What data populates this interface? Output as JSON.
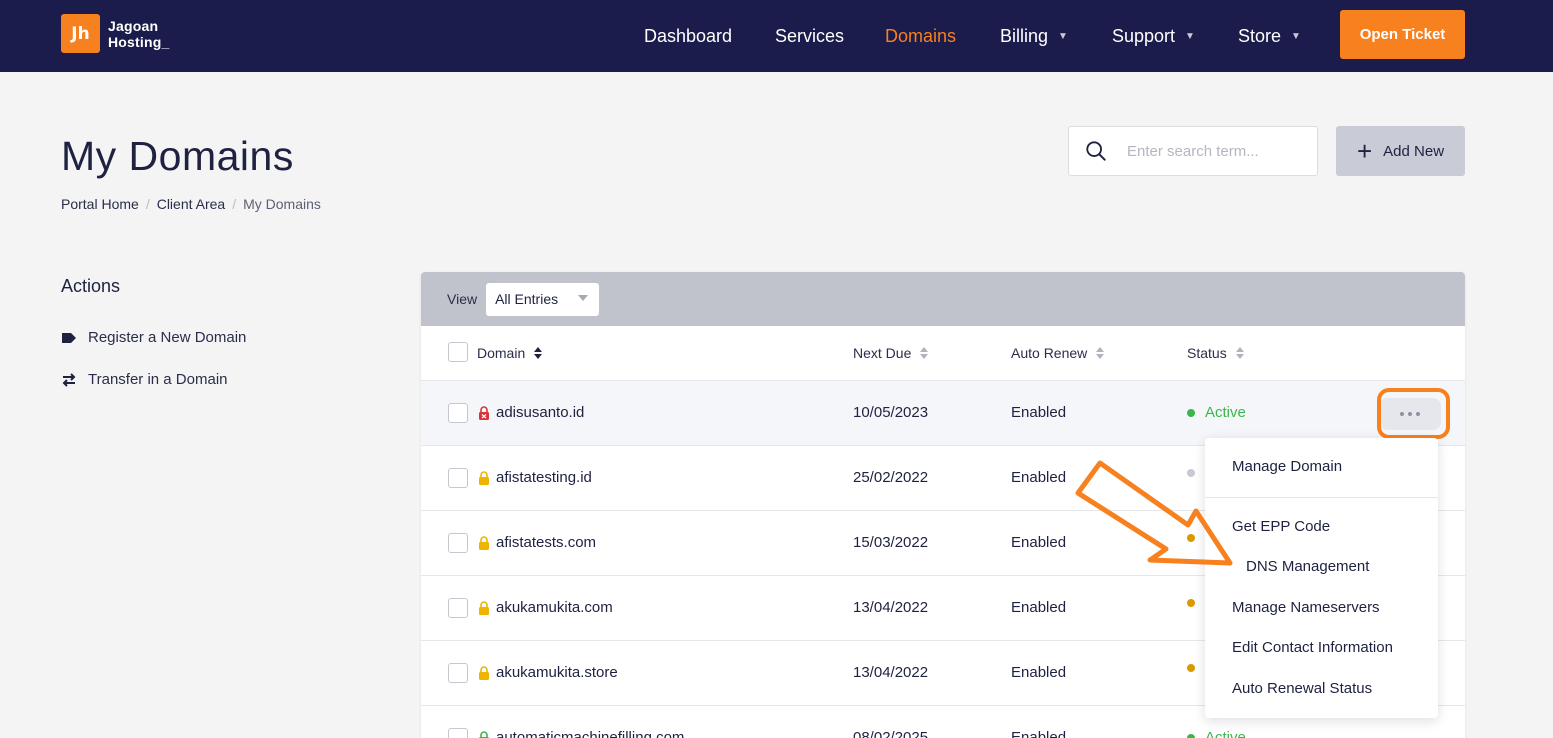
{
  "brand": {
    "mark": "Jh",
    "name": "Jagoan\nHosting_",
    "accent": "#f7801f",
    "navy": "#1b1c4b"
  },
  "nav": {
    "dashboard": "Dashboard",
    "services": "Services",
    "domains": "Domains",
    "billing": "Billing",
    "support": "Support",
    "store": "Store",
    "open_ticket": "Open Ticket"
  },
  "page": {
    "title": "My Domains"
  },
  "breadcrumb": {
    "home": "Portal Home",
    "client": "Client Area",
    "current": "My Domains",
    "sep": "/"
  },
  "search": {
    "placeholder": "Enter search term..."
  },
  "add_new": {
    "label": "Add New"
  },
  "sidebar": {
    "title": "Actions",
    "items": [
      {
        "label": "Register a New Domain",
        "icon": "tag-icon"
      },
      {
        "label": "Transfer in a Domain",
        "icon": "exchange-icon"
      }
    ]
  },
  "table": {
    "view_label": "View",
    "view_value": "All Entries",
    "columns": {
      "domain": "Domain",
      "next_due": "Next Due",
      "auto_renew": "Auto Renew",
      "status": "Status"
    },
    "rows": [
      {
        "domain": "adisusanto.id",
        "next_due": "10/05/2023",
        "auto_renew": "Enabled",
        "status": "Active"
      },
      {
        "domain": "afistatesting.id",
        "next_due": "25/02/2022",
        "auto_renew": "Enabled",
        "status": ""
      },
      {
        "domain": "afistatests.com",
        "next_due": "15/03/2022",
        "auto_renew": "Enabled",
        "status": ""
      },
      {
        "domain": "akukamukita.com",
        "next_due": "13/04/2022",
        "auto_renew": "Enabled",
        "status": ""
      },
      {
        "domain": "akukamukita.store",
        "next_due": "13/04/2022",
        "auto_renew": "Enabled",
        "status": ""
      },
      {
        "domain": "automaticmachinefilling.com",
        "next_due": "08/02/2025",
        "auto_renew": "Enabled",
        "status": "Active"
      }
    ]
  },
  "menu": {
    "manage_domain": "Manage Domain",
    "get_epp": "Get EPP Code",
    "dns": "DNS Management",
    "nameservers": "Manage Nameservers",
    "contact": "Edit Contact Information",
    "auto_renewal": "Auto Renewal Status"
  }
}
